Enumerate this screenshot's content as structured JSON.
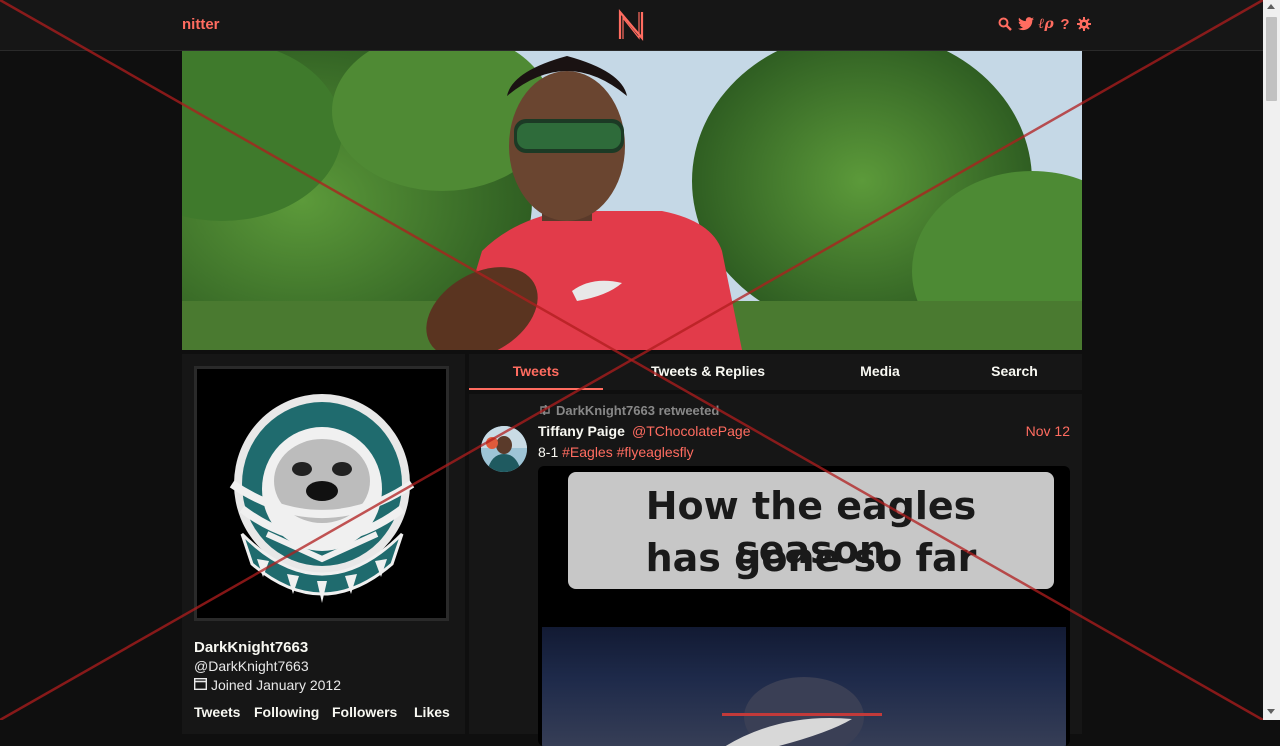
{
  "nav": {
    "brand": "nitter",
    "icons": [
      "search-icon",
      "twitter-bird-icon",
      "rss-icon",
      "help-icon",
      "gear-icon"
    ],
    "help_label": "?"
  },
  "profile": {
    "fullname": "DarkKnight7663",
    "username": "@DarkKnight7663",
    "joined": "Joined January 2012",
    "stats": [
      "Tweets",
      "Following",
      "Followers",
      "Likes"
    ]
  },
  "tabs": [
    {
      "label": "Tweets",
      "active": true
    },
    {
      "label": "Tweets & Replies",
      "active": false
    },
    {
      "label": "Media",
      "active": false
    },
    {
      "label": "Search",
      "active": false
    }
  ],
  "tweet": {
    "retweet_header": "DarkKnight7663 retweeted",
    "name": "Tiffany Paige",
    "handle": "@TChocolatePage",
    "date": "Nov 12",
    "text_prefix": "8-1 ",
    "hashtags": [
      "#Eagles",
      "#flyeaglesfly"
    ],
    "media_caption_line1": "How the eagles season",
    "media_caption_line2": "has gone so far"
  },
  "colors": {
    "accent": "#ff6c60",
    "background": "#0f0f0f",
    "panel": "#161616",
    "overlay_x": "#b01e1e"
  }
}
